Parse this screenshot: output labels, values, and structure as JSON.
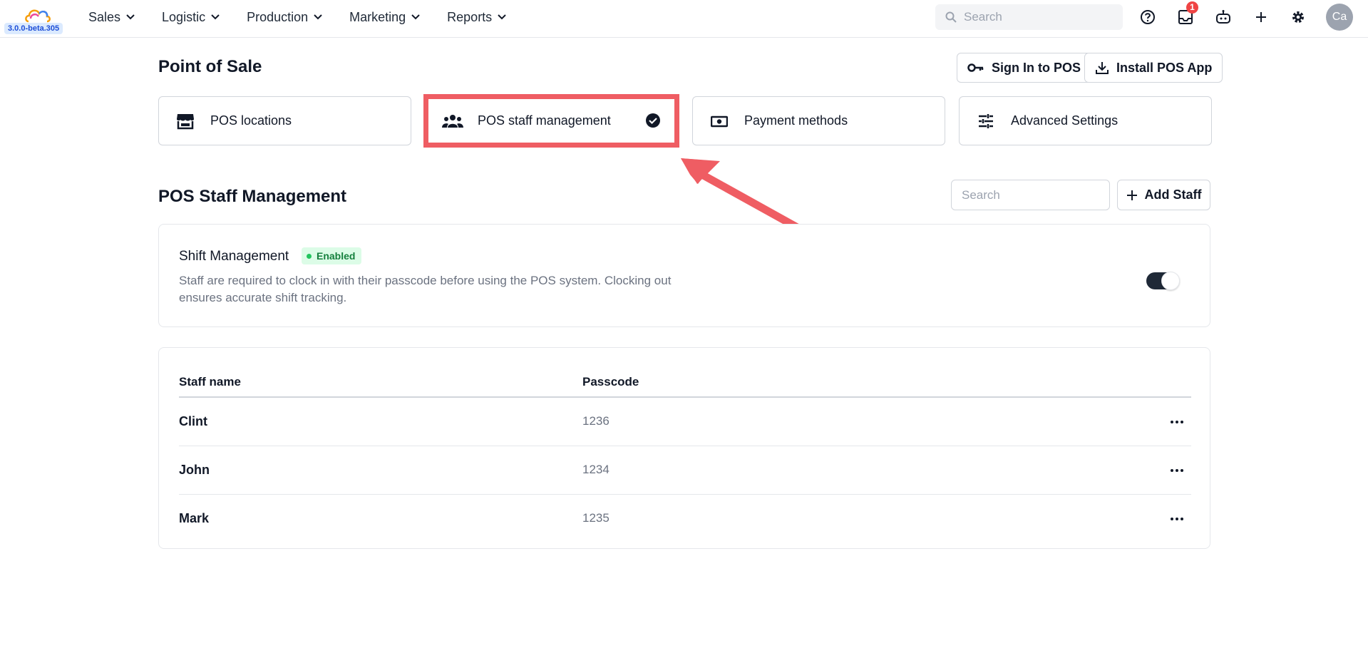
{
  "app": {
    "version": "3.0.0-beta.305",
    "logo_icon": "cloud-logo-icon",
    "accent_color": "#ef5d63"
  },
  "nav": {
    "items": [
      {
        "label": "Sales"
      },
      {
        "label": "Logistic"
      },
      {
        "label": "Production"
      },
      {
        "label": "Marketing"
      },
      {
        "label": "Reports"
      }
    ],
    "search_placeholder": "Search",
    "notification_count": "1",
    "avatar_initials": "Ca"
  },
  "page": {
    "title": "Point of Sale",
    "sign_in_label": "Sign In to POS",
    "install_label": "Install POS App"
  },
  "tabs": [
    {
      "label": "POS locations",
      "icon": "store-icon"
    },
    {
      "label": "POS staff management",
      "icon": "users-icon",
      "selected": true
    },
    {
      "label": "Payment methods",
      "icon": "money-icon"
    },
    {
      "label": "Advanced Settings",
      "icon": "sliders-icon"
    }
  ],
  "section": {
    "title": "POS Staff Management",
    "search_placeholder": "Search",
    "add_label": "Add Staff"
  },
  "shift": {
    "title": "Shift Management",
    "status": "Enabled",
    "status_color": "#15803d",
    "description": "Staff are required to clock in with their passcode before using the POS system. Clocking out ensures accurate shift tracking.",
    "toggle_on": true
  },
  "table": {
    "columns": [
      "Staff name",
      "Passcode"
    ],
    "rows": [
      {
        "name": "Clint",
        "passcode": "1236"
      },
      {
        "name": "John",
        "passcode": "1234"
      },
      {
        "name": "Mark",
        "passcode": "1235"
      }
    ]
  }
}
